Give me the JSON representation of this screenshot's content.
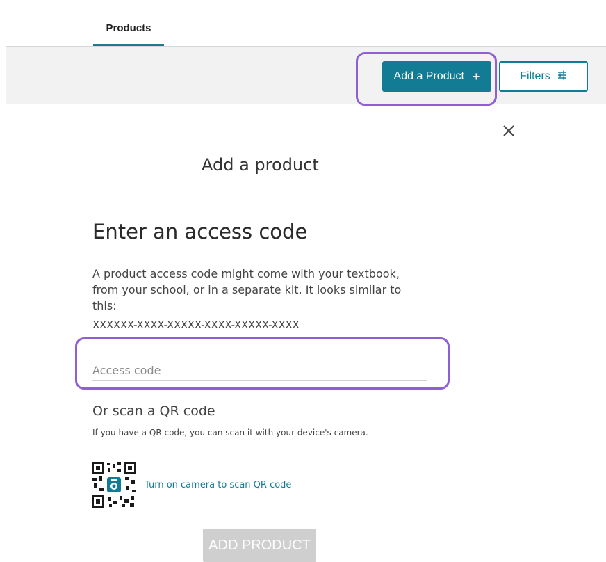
{
  "tabs": [
    {
      "label": "Products",
      "active": true
    }
  ],
  "toolbar": {
    "add_product_label": "Add a Product",
    "add_product_icon": "plus-icon",
    "add_product_glyph": "+",
    "filters_label": "Filters",
    "filters_icon": "sliders-icon"
  },
  "modal": {
    "close_icon": "close-icon",
    "title": "Add a product",
    "section_heading": "Enter an access code",
    "description": "A product access code might come with your textbook, from your school, or in a separate kit. It looks similar to this:",
    "sample_code": "XXXXXX-XXXX-XXXXX-XXXX-XXXXX-XXXX",
    "access_input": {
      "placeholder": "Access code",
      "value": ""
    },
    "qr": {
      "heading": "Or scan a QR code",
      "help_text": "If you have a QR code, you can scan it with your device's camera.",
      "icon": "qr-camera-icon",
      "link_label": "Turn on camera to scan QR code"
    },
    "submit_label": "ADD PRODUCT",
    "submit_enabled": false
  },
  "colors": {
    "primary": "#127c94",
    "highlight": "#8f5fd6",
    "toolbar_bg": "#f2f2f2",
    "disabled_button": "#cfcfcf"
  }
}
